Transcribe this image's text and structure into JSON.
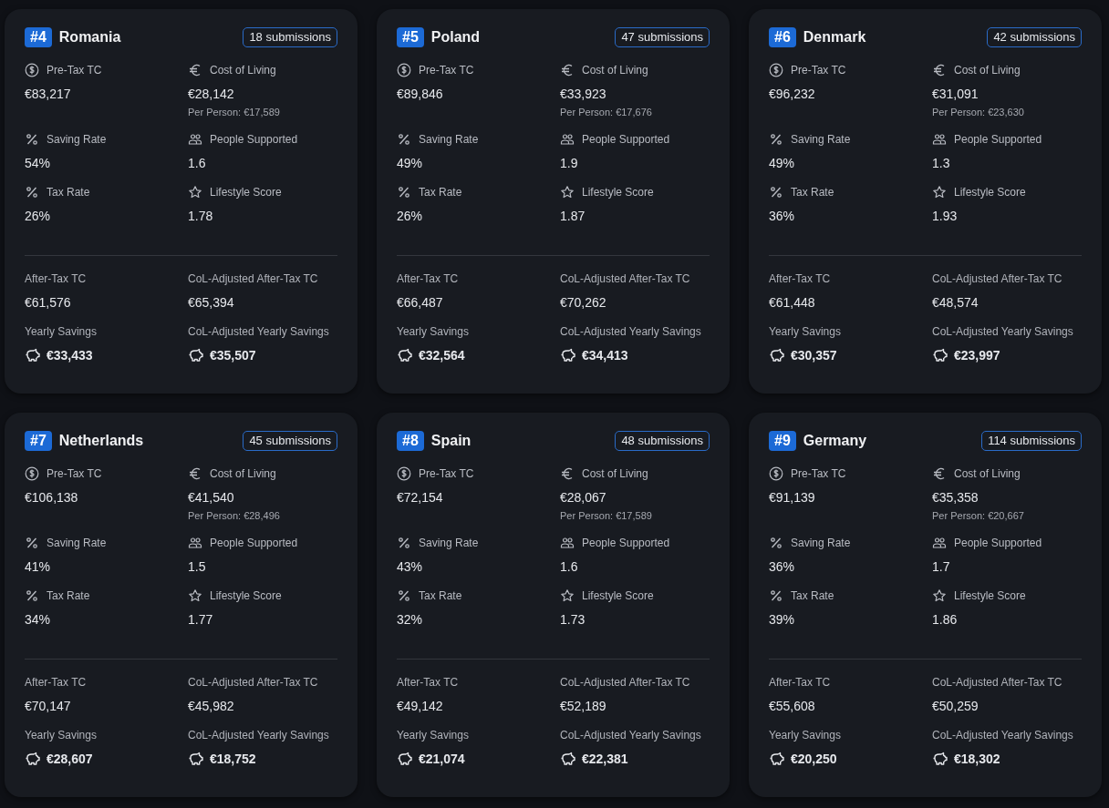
{
  "cards": [
    {
      "rank": "#4",
      "country": "Romania",
      "submissions": "18 submissions",
      "stats": [
        {
          "kind": "dollar",
          "label": "Pre-Tax TC",
          "value": "€83,217"
        },
        {
          "kind": "euro",
          "label": "Cost of Living",
          "value": "€28,142",
          "note": "Per Person: €17,589"
        },
        {
          "kind": "percent",
          "label": "Saving Rate",
          "value": "54%"
        },
        {
          "kind": "people",
          "label": "People Supported",
          "value": "1.6"
        },
        {
          "kind": "percent",
          "label": "Tax Rate",
          "value": "26%"
        },
        {
          "kind": "star",
          "label": "Lifestyle Score",
          "value": "1.78"
        }
      ],
      "totals": [
        {
          "kind": "plain",
          "label": "After-Tax TC",
          "value": "€61,576"
        },
        {
          "kind": "plain",
          "label": "CoL-Adjusted After-Tax TC",
          "value": "€65,394"
        },
        {
          "kind": "savings",
          "label": "Yearly Savings",
          "value": "€33,433"
        },
        {
          "kind": "savings",
          "label": "CoL-Adjusted Yearly Savings",
          "value": "€35,507"
        }
      ]
    },
    {
      "rank": "#5",
      "country": "Poland",
      "submissions": "47 submissions",
      "stats": [
        {
          "kind": "dollar",
          "label": "Pre-Tax TC",
          "value": "€89,846"
        },
        {
          "kind": "euro",
          "label": "Cost of Living",
          "value": "€33,923",
          "note": "Per Person: €17,676"
        },
        {
          "kind": "percent",
          "label": "Saving Rate",
          "value": "49%"
        },
        {
          "kind": "people",
          "label": "People Supported",
          "value": "1.9"
        },
        {
          "kind": "percent",
          "label": "Tax Rate",
          "value": "26%"
        },
        {
          "kind": "star",
          "label": "Lifestyle Score",
          "value": "1.87"
        }
      ],
      "totals": [
        {
          "kind": "plain",
          "label": "After-Tax TC",
          "value": "€66,487"
        },
        {
          "kind": "plain",
          "label": "CoL-Adjusted After-Tax TC",
          "value": "€70,262"
        },
        {
          "kind": "savings",
          "label": "Yearly Savings",
          "value": "€32,564"
        },
        {
          "kind": "savings",
          "label": "CoL-Adjusted Yearly Savings",
          "value": "€34,413"
        }
      ]
    },
    {
      "rank": "#6",
      "country": "Denmark",
      "submissions": "42 submissions",
      "stats": [
        {
          "kind": "dollar",
          "label": "Pre-Tax TC",
          "value": "€96,232"
        },
        {
          "kind": "euro",
          "label": "Cost of Living",
          "value": "€31,091",
          "note": "Per Person: €23,630"
        },
        {
          "kind": "percent",
          "label": "Saving Rate",
          "value": "49%"
        },
        {
          "kind": "people",
          "label": "People Supported",
          "value": "1.3"
        },
        {
          "kind": "percent",
          "label": "Tax Rate",
          "value": "36%"
        },
        {
          "kind": "star",
          "label": "Lifestyle Score",
          "value": "1.93"
        }
      ],
      "totals": [
        {
          "kind": "plain",
          "label": "After-Tax TC",
          "value": "€61,448"
        },
        {
          "kind": "plain",
          "label": "CoL-Adjusted After-Tax TC",
          "value": "€48,574"
        },
        {
          "kind": "savings",
          "label": "Yearly Savings",
          "value": "€30,357"
        },
        {
          "kind": "savings",
          "label": "CoL-Adjusted Yearly Savings",
          "value": "€23,997"
        }
      ]
    },
    {
      "rank": "#7",
      "country": "Netherlands",
      "submissions": "45 submissions",
      "stats": [
        {
          "kind": "dollar",
          "label": "Pre-Tax TC",
          "value": "€106,138"
        },
        {
          "kind": "euro",
          "label": "Cost of Living",
          "value": "€41,540",
          "note": "Per Person: €28,496"
        },
        {
          "kind": "percent",
          "label": "Saving Rate",
          "value": "41%"
        },
        {
          "kind": "people",
          "label": "People Supported",
          "value": "1.5"
        },
        {
          "kind": "percent",
          "label": "Tax Rate",
          "value": "34%"
        },
        {
          "kind": "star",
          "label": "Lifestyle Score",
          "value": "1.77"
        }
      ],
      "totals": [
        {
          "kind": "plain",
          "label": "After-Tax TC",
          "value": "€70,147"
        },
        {
          "kind": "plain",
          "label": "CoL-Adjusted After-Tax TC",
          "value": "€45,982"
        },
        {
          "kind": "savings",
          "label": "Yearly Savings",
          "value": "€28,607"
        },
        {
          "kind": "savings",
          "label": "CoL-Adjusted Yearly Savings",
          "value": "€18,752"
        }
      ]
    },
    {
      "rank": "#8",
      "country": "Spain",
      "submissions": "48 submissions",
      "stats": [
        {
          "kind": "dollar",
          "label": "Pre-Tax TC",
          "value": "€72,154"
        },
        {
          "kind": "euro",
          "label": "Cost of Living",
          "value": "€28,067",
          "note": "Per Person: €17,589"
        },
        {
          "kind": "percent",
          "label": "Saving Rate",
          "value": "43%"
        },
        {
          "kind": "people",
          "label": "People Supported",
          "value": "1.6"
        },
        {
          "kind": "percent",
          "label": "Tax Rate",
          "value": "32%"
        },
        {
          "kind": "star",
          "label": "Lifestyle Score",
          "value": "1.73"
        }
      ],
      "totals": [
        {
          "kind": "plain",
          "label": "After-Tax TC",
          "value": "€49,142"
        },
        {
          "kind": "plain",
          "label": "CoL-Adjusted After-Tax TC",
          "value": "€52,189"
        },
        {
          "kind": "savings",
          "label": "Yearly Savings",
          "value": "€21,074"
        },
        {
          "kind": "savings",
          "label": "CoL-Adjusted Yearly Savings",
          "value": "€22,381"
        }
      ]
    },
    {
      "rank": "#9",
      "country": "Germany",
      "submissions": "114 submissions",
      "stats": [
        {
          "kind": "dollar",
          "label": "Pre-Tax TC",
          "value": "€91,139"
        },
        {
          "kind": "euro",
          "label": "Cost of Living",
          "value": "€35,358",
          "note": "Per Person: €20,667"
        },
        {
          "kind": "percent",
          "label": "Saving Rate",
          "value": "36%"
        },
        {
          "kind": "people",
          "label": "People Supported",
          "value": "1.7"
        },
        {
          "kind": "percent",
          "label": "Tax Rate",
          "value": "39%"
        },
        {
          "kind": "star",
          "label": "Lifestyle Score",
          "value": "1.86"
        }
      ],
      "totals": [
        {
          "kind": "plain",
          "label": "After-Tax TC",
          "value": "€55,608"
        },
        {
          "kind": "plain",
          "label": "CoL-Adjusted After-Tax TC",
          "value": "€50,259"
        },
        {
          "kind": "savings",
          "label": "Yearly Savings",
          "value": "€20,250"
        },
        {
          "kind": "savings",
          "label": "CoL-Adjusted Yearly Savings",
          "value": "€18,302"
        }
      ]
    }
  ]
}
